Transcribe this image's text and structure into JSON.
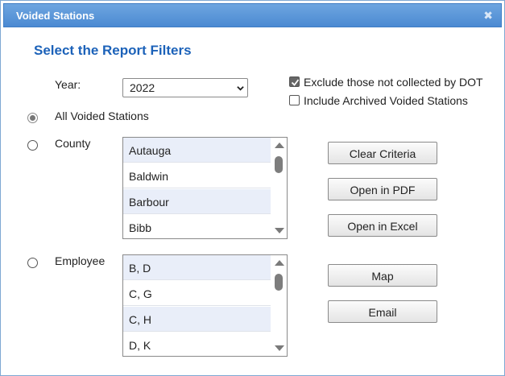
{
  "window": {
    "title": "Voided Stations",
    "close_glyph": "✖"
  },
  "heading": "Select the Report Filters",
  "year": {
    "label": "Year:",
    "value": "2022"
  },
  "options": {
    "exclude_not_collected": {
      "label": "Exclude those not collected by DOT",
      "checked": true
    },
    "include_archived": {
      "label": "Include Archived Voided Stations",
      "checked": false
    }
  },
  "filters": {
    "all": {
      "label": "All Voided Stations",
      "selected": true
    },
    "county": {
      "label": "County",
      "selected": false,
      "items": [
        "Autauga",
        "Baldwin",
        "Barbour",
        "Bibb"
      ]
    },
    "employee": {
      "label": "Employee",
      "selected": false,
      "items": [
        "B, D",
        "C, G",
        "C, H",
        "D, K"
      ]
    }
  },
  "buttons": {
    "clear": "Clear Criteria",
    "pdf": "Open in PDF",
    "excel": "Open in Excel",
    "map": "Map",
    "email": "Email"
  },
  "colors": {
    "title_bar": "#4b8ad2",
    "heading": "#1c62b9",
    "list_alt_row": "#e9eef9"
  }
}
